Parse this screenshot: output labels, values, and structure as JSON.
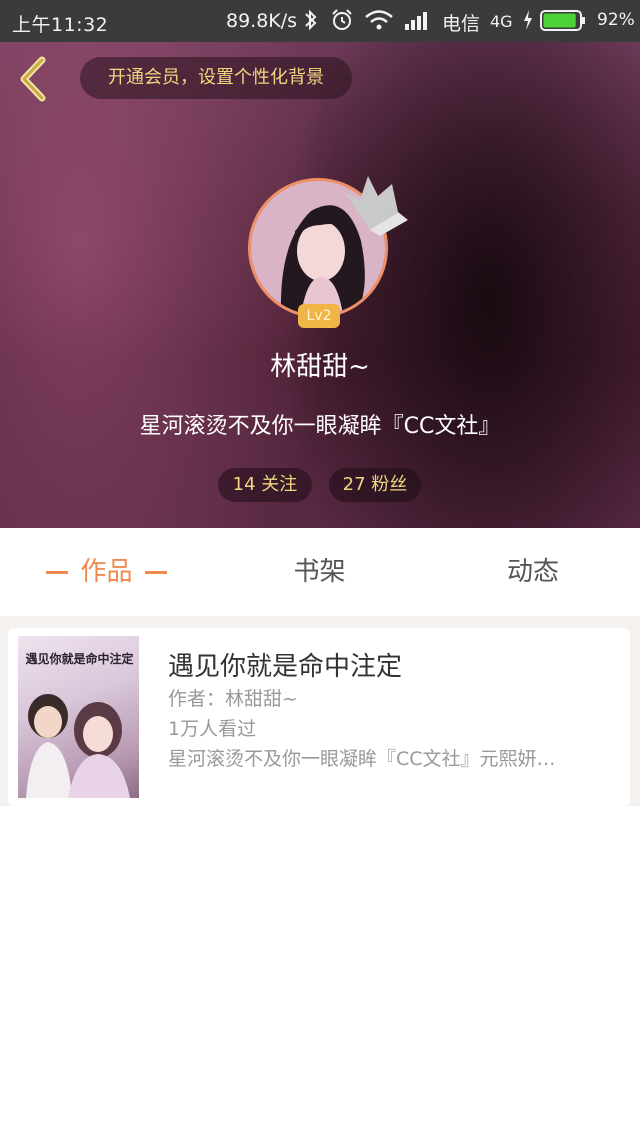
{
  "status_bar": {
    "time": "上午11:32",
    "net_speed": "89.8K/s",
    "carrier": "电信",
    "network": "4G",
    "battery_pct": "92%",
    "battery_level": 0.92
  },
  "header": {
    "vip_prompt": "开通会员，设置个性化背景",
    "level": "Lv2",
    "username": "林甜甜~",
    "signature": "星河滚烫不及你一眼凝眸『CC文社』",
    "follow": "14 关注",
    "fans": "27 粉丝"
  },
  "tabs": [
    {
      "label": "作品",
      "active": true
    },
    {
      "label": "书架",
      "active": false
    },
    {
      "label": "动态",
      "active": false
    }
  ],
  "book": {
    "cover_title": "遇见你就是命中注定",
    "title": "遇见你就是命中注定",
    "author": "作者：林甜甜~",
    "views": "1万人看过",
    "description": "星河滚烫不及你一眼凝眸『CC文社』元熙妍…"
  },
  "colors": {
    "accent": "#f0894e",
    "gold": "#f3d580",
    "level_badge": "#f0b544",
    "avatar_ring": "#ef8f66"
  }
}
